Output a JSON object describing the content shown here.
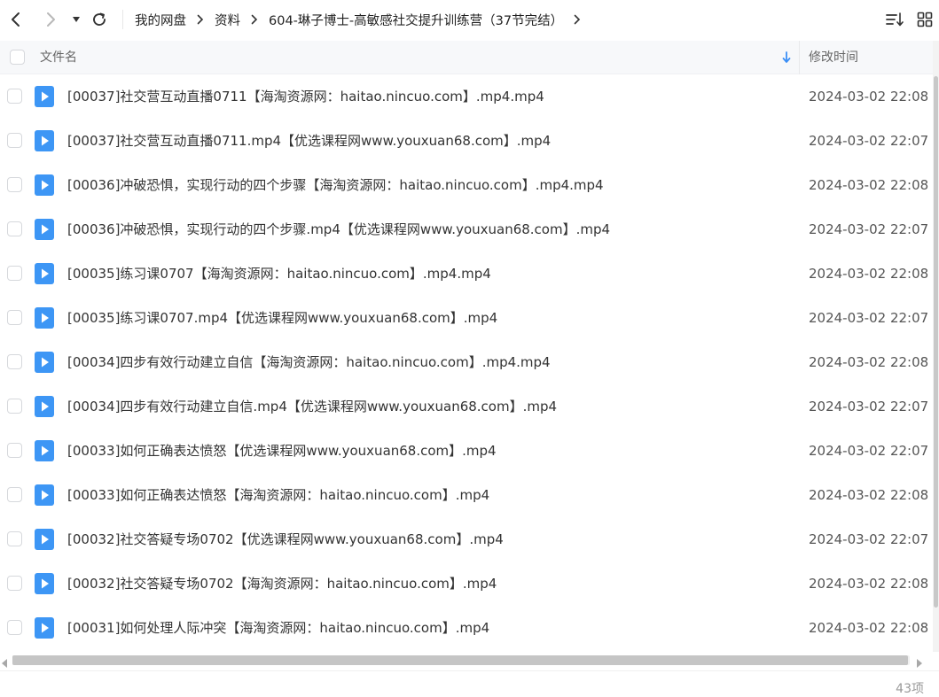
{
  "nav": {
    "back": "arrow-left-icon",
    "forward": "arrow-right-icon",
    "history": "history-dropdown-icon",
    "refresh": "refresh-icon"
  },
  "breadcrumb": [
    {
      "label": "我的网盘"
    },
    {
      "label": "资料"
    },
    {
      "label": "604-琳子博士-高敏感社交提升训练营（37节完结）"
    }
  ],
  "tools": {
    "sort": "sort-list-icon",
    "view": "grid-view-icon"
  },
  "table": {
    "name_header": "文件名",
    "time_header": "修改时间",
    "sort_icon": "sort-arrow-down-icon",
    "rows": [
      {
        "name": "[00037]社交营互动直播0711【海淘资源网：haitao.nincuo.com】.mp4.mp4",
        "time": "2024-03-02 22:08"
      },
      {
        "name": "[00037]社交营互动直播0711.mp4【优选课程网www.youxuan68.com】.mp4",
        "time": "2024-03-02 22:07"
      },
      {
        "name": "[00036]冲破恐惧，实现行动的四个步骤【海淘资源网：haitao.nincuo.com】.mp4.mp4",
        "time": "2024-03-02 22:08"
      },
      {
        "name": "[00036]冲破恐惧，实现行动的四个步骤.mp4【优选课程网www.youxuan68.com】.mp4",
        "time": "2024-03-02 22:07"
      },
      {
        "name": "[00035]练习课0707【海淘资源网：haitao.nincuo.com】.mp4.mp4",
        "time": "2024-03-02 22:08"
      },
      {
        "name": "[00035]练习课0707.mp4【优选课程网www.youxuan68.com】.mp4",
        "time": "2024-03-02 22:07"
      },
      {
        "name": "[00034]四步有效行动建立自信【海淘资源网：haitao.nincuo.com】.mp4.mp4",
        "time": "2024-03-02 22:08"
      },
      {
        "name": "[00034]四步有效行动建立自信.mp4【优选课程网www.youxuan68.com】.mp4",
        "time": "2024-03-02 22:07"
      },
      {
        "name": "[00033]如何正确表达愤怒【优选课程网www.youxuan68.com】.mp4",
        "time": "2024-03-02 22:07"
      },
      {
        "name": "[00033]如何正确表达愤怒【海淘资源网：haitao.nincuo.com】.mp4",
        "time": "2024-03-02 22:08"
      },
      {
        "name": "[00032]社交答疑专场0702【优选课程网www.youxuan68.com】.mp4",
        "time": "2024-03-02 22:07"
      },
      {
        "name": "[00032]社交答疑专场0702【海淘资源网：haitao.nincuo.com】.mp4",
        "time": "2024-03-02 22:08"
      },
      {
        "name": "[00031]如何处理人际冲突【海淘资源网：haitao.nincuo.com】.mp4",
        "time": "2024-03-02 22:08"
      }
    ]
  },
  "footer": {
    "count": "43项"
  },
  "colors": {
    "accent": "#3a8ef6",
    "video_icon": "#3d96f5"
  }
}
